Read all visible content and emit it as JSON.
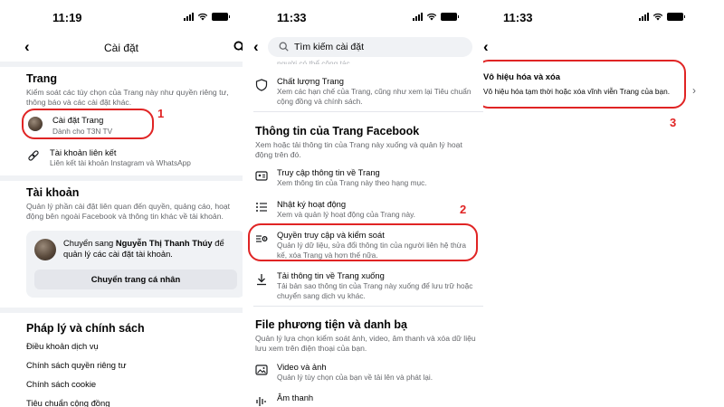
{
  "screen1": {
    "status_time": "11:19",
    "title": "Cài đặt",
    "trang": {
      "title": "Trang",
      "desc": "Kiểm soát các tùy chọn của Trang này như quyền riêng tư, thông báo và các cài đặt khác.",
      "items": [
        {
          "title": "Cài đặt Trang",
          "sub": "Dành cho T3N TV"
        },
        {
          "title": "Tài khoản liên kết",
          "sub": "Liên kết tài khoản Instagram và WhatsApp"
        }
      ]
    },
    "tai_khoan": {
      "title": "Tài khoản",
      "desc": "Quản lý phần cài đặt liên quan đến quyền, quảng cáo, hoạt động bên ngoài Facebook và thông tin khác về tài khoản.",
      "switch_prefix": "Chuyển sang ",
      "switch_name": "Nguyễn Thị Thanh Thúy",
      "switch_suffix": " để quản lý các cài đặt tài khoản.",
      "switch_button": "Chuyển trang cá nhân"
    },
    "phap_ly": {
      "title": "Pháp lý và chính sách",
      "links": [
        "Điều khoản dịch vụ",
        "Chính sách quyền riêng tư",
        "Chính sách cookie",
        "Tiêu chuẩn cộng đồng"
      ]
    },
    "marker": "1"
  },
  "screen2": {
    "status_time": "11:33",
    "search_placeholder": "Tìm kiếm cài đặt",
    "partial_top": "người có thể cộng tác",
    "chat_luong": {
      "title": "Chất lượng Trang",
      "sub": "Xem các hạn chế của Trang, cũng như xem lại Tiêu chuẩn cộng đồng và chính sách."
    },
    "thong_tin": {
      "title": "Thông tin của Trang Facebook",
      "desc": "Xem hoặc tải thông tin của Trang này xuống và quản lý hoạt động trên đó.",
      "items": [
        {
          "title": "Truy cập thông tin về Trang",
          "sub": "Xem thông tin của Trang này theo hạng mục."
        },
        {
          "title": "Nhật ký hoạt động",
          "sub": "Xem và quản lý hoạt động của Trang này."
        },
        {
          "title": "Quyền truy cập và kiểm soát",
          "sub": "Quản lý dữ liệu, sửa đổi thông tin của người liên hệ thừa kế, xóa Trang và hơn thế nữa."
        },
        {
          "title": "Tải thông tin về Trang xuống",
          "sub": "Tải bản sao thông tin của Trang này xuống để lưu trữ hoặc chuyển sang dịch vụ khác."
        }
      ]
    },
    "file": {
      "title": "File phương tiện và danh bạ",
      "desc": "Quản lý lựa chọn kiểm soát ảnh, video, âm thanh và xóa dữ liệu lưu xem trên điện thoại của bạn.",
      "items": [
        {
          "title": "Video và ảnh",
          "sub": "Quản lý tùy chọn của bạn về tải lên và phát lại."
        },
        {
          "title": "Âm thanh",
          "sub": ""
        }
      ]
    },
    "marker": "2"
  },
  "screen3": {
    "status_time": "11:33",
    "option_title": "Vô hiệu hóa và xóa",
    "option_sub": "Vô hiệu hóa tạm thời hoặc xóa vĩnh viễn Trang của bạn.",
    "marker": "3"
  },
  "colors": {
    "accent_red": "#e02424",
    "text": "#050505",
    "muted": "#65676b",
    "divider": "#f0f2f5"
  }
}
